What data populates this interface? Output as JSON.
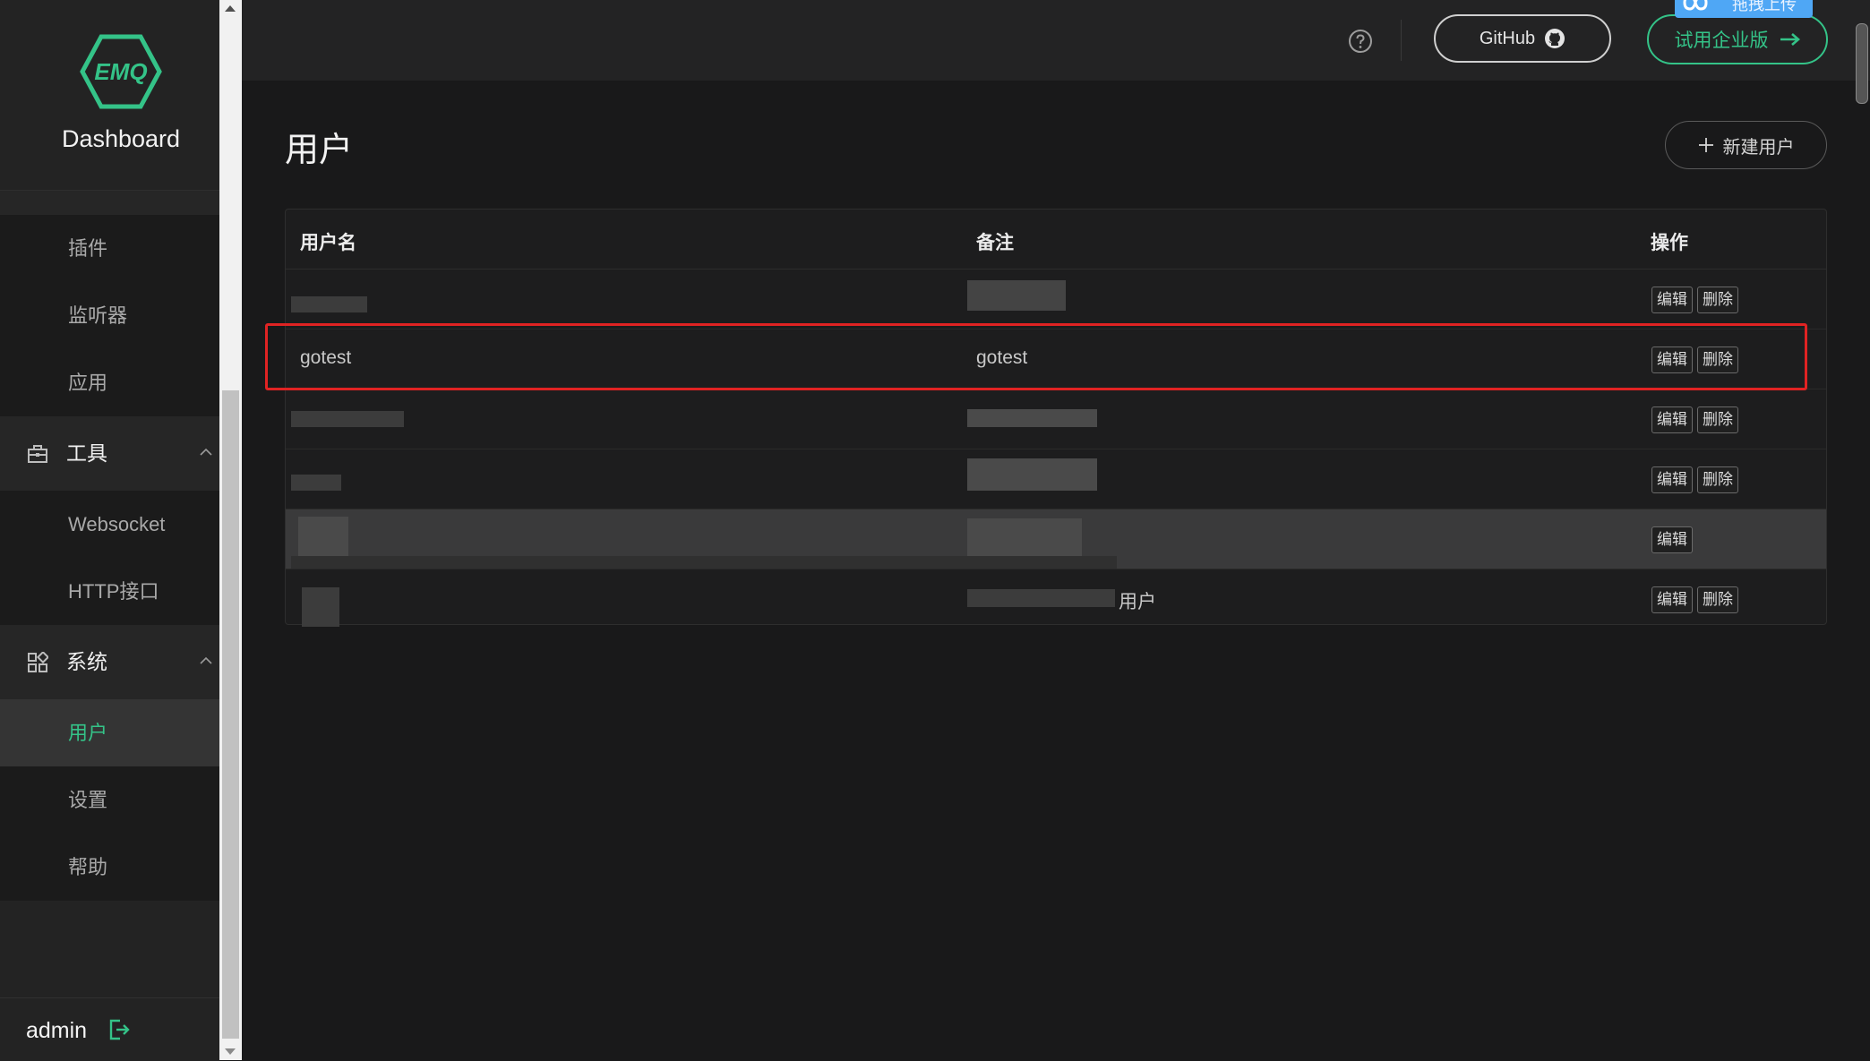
{
  "app": {
    "logo_text": "EMQ",
    "title": "Dashboard"
  },
  "sidebar": {
    "submenu_top": [
      {
        "label": "插件"
      },
      {
        "label": "监听器"
      },
      {
        "label": "应用"
      }
    ],
    "groups": [
      {
        "label": "工具",
        "icon": "toolbox-icon",
        "expanded": true,
        "items": [
          {
            "label": "Websocket"
          },
          {
            "label": "HTTP接口"
          }
        ]
      },
      {
        "label": "系统",
        "icon": "grid-icon",
        "expanded": true,
        "items": [
          {
            "label": "用户",
            "active": true
          },
          {
            "label": "设置"
          },
          {
            "label": "帮助"
          }
        ]
      }
    ],
    "user": "admin"
  },
  "header": {
    "help_icon": "question-circle-icon",
    "github_label": "GitHub",
    "enterprise_label": "试用企业版",
    "overlay_badge_label": "拖拽上传"
  },
  "page": {
    "title": "用户",
    "new_button_label": "新建用户"
  },
  "table": {
    "columns": [
      "用户名",
      "备注",
      "操作"
    ],
    "rows": [
      {
        "username": "",
        "note": "",
        "actions": [
          "编辑",
          "删除"
        ],
        "obscured": true
      },
      {
        "username": "gotest",
        "note": "gotest",
        "actions": [
          "编辑",
          "删除"
        ],
        "highlighted": true
      },
      {
        "username": "",
        "note": "",
        "actions": [
          "编辑",
          "删除"
        ],
        "obscured": true
      },
      {
        "username": "",
        "note": "",
        "actions": [
          "编辑",
          "删除"
        ],
        "obscured": true
      },
      {
        "username": "",
        "note": "",
        "actions": [
          "编辑"
        ],
        "obscured": true,
        "hovered": true
      },
      {
        "username": "",
        "note": "用户",
        "actions": [
          "编辑",
          "删除"
        ],
        "obscured": true
      }
    ]
  },
  "colors": {
    "accent": "#34c388",
    "highlight": "#e02323",
    "background": "#19191a",
    "sidebar": "#232323"
  }
}
